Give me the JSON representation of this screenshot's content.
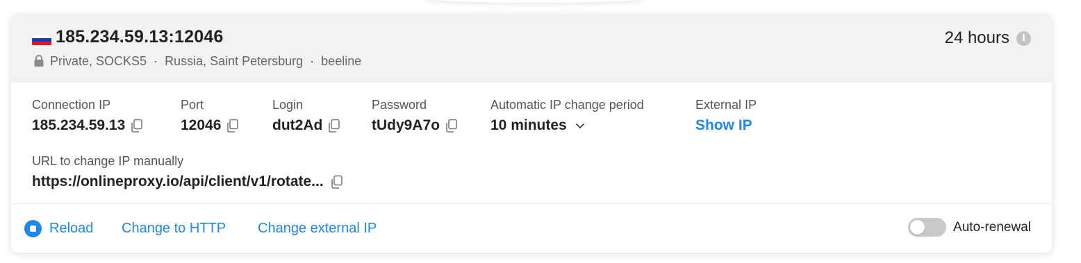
{
  "proxy": {
    "address": "185.234.59.13:12046",
    "type": "Private, SOCKS5",
    "location": "Russia, Saint Petersburg",
    "operator": "beeline",
    "duration": "24 hours",
    "flag_colors": [
      "#ffffff",
      "#1c39bb",
      "#e4181c"
    ]
  },
  "fields": {
    "connection_ip": {
      "label": "Connection IP",
      "value": "185.234.59.13"
    },
    "port": {
      "label": "Port",
      "value": "12046"
    },
    "login": {
      "label": "Login",
      "value": "dut2Ad"
    },
    "password": {
      "label": "Password",
      "value": "tUdy9A7o"
    },
    "ip_change_period": {
      "label": "Automatic IP change period",
      "value": "10 minutes"
    },
    "external_ip": {
      "label": "External IP",
      "value": "Show IP"
    },
    "change_url": {
      "label": "URL to change IP manually",
      "value": "https://onlineproxy.io/api/client/v1/rotate..."
    }
  },
  "footer": {
    "reload": "Reload",
    "change_to_http": "Change to HTTP",
    "change_external_ip": "Change external IP",
    "auto_renewal": "Auto-renewal",
    "auto_renewal_on": false
  },
  "colors": {
    "accent": "#1e88e5",
    "header_bg": "#f2f2f2"
  },
  "icons": [
    "flag-russia-icon",
    "lock-icon",
    "info-icon",
    "copy-icon",
    "chevron-down-icon",
    "reload-icon"
  ]
}
